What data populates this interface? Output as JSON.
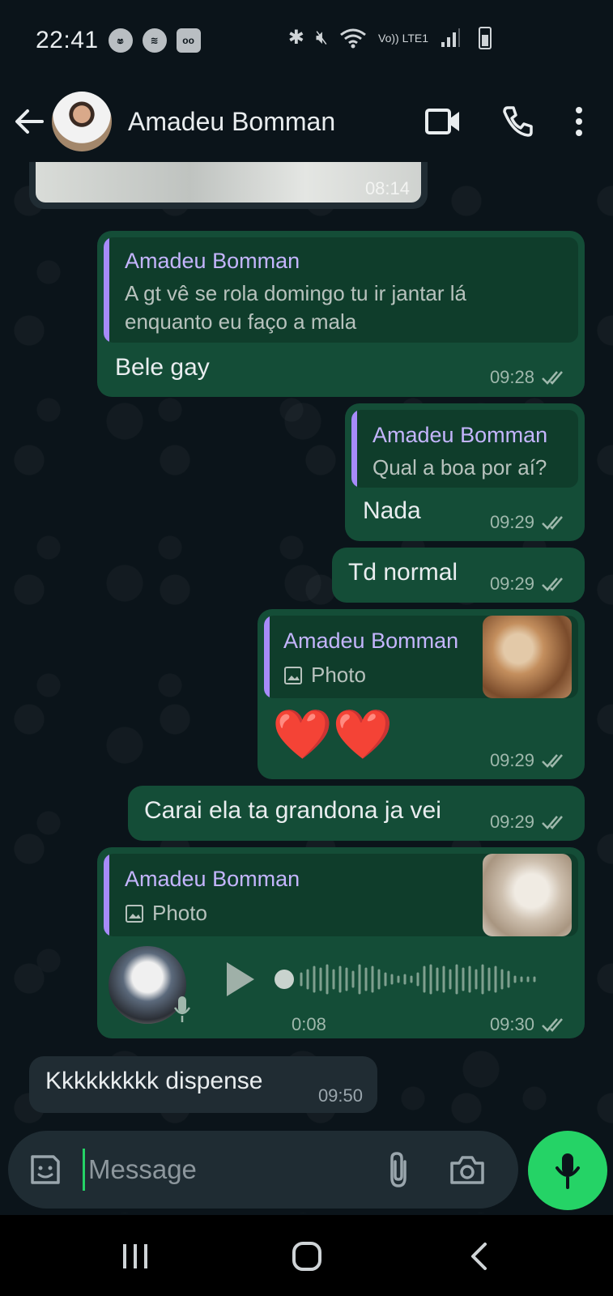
{
  "status_bar": {
    "time": "22:41",
    "network_label": "Vo)) LTE1",
    "left_icons": [
      "carrier-badge-icon",
      "spotify-icon",
      "voicemail-icon"
    ],
    "right_icons": [
      "bluetooth-icon",
      "mute-icon",
      "wifi-icon",
      "signal-icon",
      "battery-icon"
    ]
  },
  "header": {
    "contact_name": "Amadeu Bomman",
    "icons": [
      "back-arrow-icon",
      "video-call-icon",
      "phone-call-icon",
      "more-vert-icon"
    ]
  },
  "messages": [
    {
      "id": "m0",
      "direction": "in",
      "type": "image",
      "time": "08:14"
    },
    {
      "id": "m1",
      "direction": "out",
      "quote": {
        "name": "Amadeu Bomman",
        "text": "A gt vê se rola domingo tu ir jantar lá enquanto eu faço a mala"
      },
      "text": "Bele gay",
      "time": "09:28",
      "status": "read"
    },
    {
      "id": "m2",
      "direction": "out",
      "quote": {
        "name": "Amadeu Bomman",
        "text": "Qual a boa por aí?"
      },
      "text": "Nada",
      "time": "09:29",
      "status": "read"
    },
    {
      "id": "m3",
      "direction": "out",
      "text": "Td normal",
      "time": "09:29",
      "status": "read"
    },
    {
      "id": "m4",
      "direction": "out",
      "quote": {
        "name": "Amadeu Bomman",
        "text": "Photo"
      },
      "text": "❤️❤️",
      "time": "09:29",
      "status": "read"
    },
    {
      "id": "m5",
      "direction": "out",
      "text": "Carai ela ta grandona ja vei",
      "time": "09:29",
      "status": "read"
    },
    {
      "id": "m6",
      "direction": "out",
      "quote": {
        "name": "Amadeu Bomman",
        "text": "Photo"
      },
      "type": "voice",
      "duration": "0:08",
      "time": "09:30",
      "status": "read"
    },
    {
      "id": "m7",
      "direction": "in",
      "text": "Kkkkkkkkk dispense",
      "time": "09:50"
    }
  ],
  "composer": {
    "placeholder": "Message",
    "icons": [
      "sticker-icon",
      "attach-icon",
      "camera-icon",
      "mic-icon"
    ]
  },
  "colors": {
    "background": "#0b141a",
    "outgoing_bubble": "#144d37",
    "incoming_bubble": "#202c33",
    "quote_bar": "#a78bfa",
    "quote_name": "#c4b5fd",
    "accent_green": "#25d366",
    "read_ticks": "#9fb8ac"
  },
  "nav": {
    "icons": [
      "recents-icon",
      "home-icon",
      "back-nav-icon"
    ]
  }
}
